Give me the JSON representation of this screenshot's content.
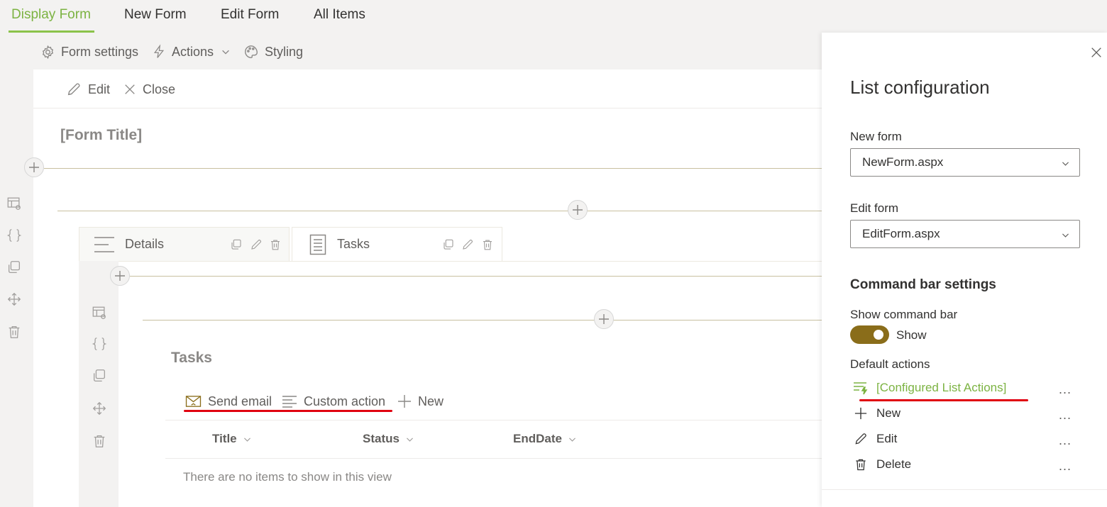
{
  "tabs": [
    {
      "label": "Display Form",
      "active": true
    },
    {
      "label": "New Form"
    },
    {
      "label": "Edit Form"
    },
    {
      "label": "All Items"
    }
  ],
  "toolbar": {
    "form_settings": "Form settings",
    "actions": "Actions",
    "styling": "Styling"
  },
  "command_bar": {
    "edit": "Edit",
    "close": "Close"
  },
  "form_title": "[Form Title]",
  "container_tabs": [
    {
      "label": "Details",
      "icon": "lines-icon"
    },
    {
      "label": "Tasks",
      "icon": "document-list-icon"
    }
  ],
  "list": {
    "title": "Tasks",
    "commands": {
      "send_email": "Send email",
      "custom_action": "Custom action",
      "new": "New"
    },
    "columns": [
      "Title",
      "Status",
      "EndDate"
    ],
    "empty_message": "There are no items to show in this view"
  },
  "panel": {
    "title": "List configuration",
    "new_form_label": "New form",
    "new_form_value": "NewForm.aspx",
    "edit_form_label": "Edit form",
    "edit_form_value": "EditForm.aspx",
    "command_bar_heading": "Command bar settings",
    "show_command_bar_label": "Show command bar",
    "toggle_text": "Show",
    "toggle_on": true,
    "default_actions_label": "Default actions",
    "actions": [
      {
        "label": "[Configured List Actions]",
        "icon": "list-lightning-icon",
        "highlight": true
      },
      {
        "label": "New",
        "icon": "plus-icon"
      },
      {
        "label": "Edit",
        "icon": "pencil-icon"
      },
      {
        "label": "Delete",
        "icon": "trash-icon"
      }
    ],
    "more_label": "..."
  },
  "colors": {
    "accent_green": "#7cb342",
    "toggle_gold": "#8a6d1a",
    "highlight_underline": "#e00010"
  }
}
